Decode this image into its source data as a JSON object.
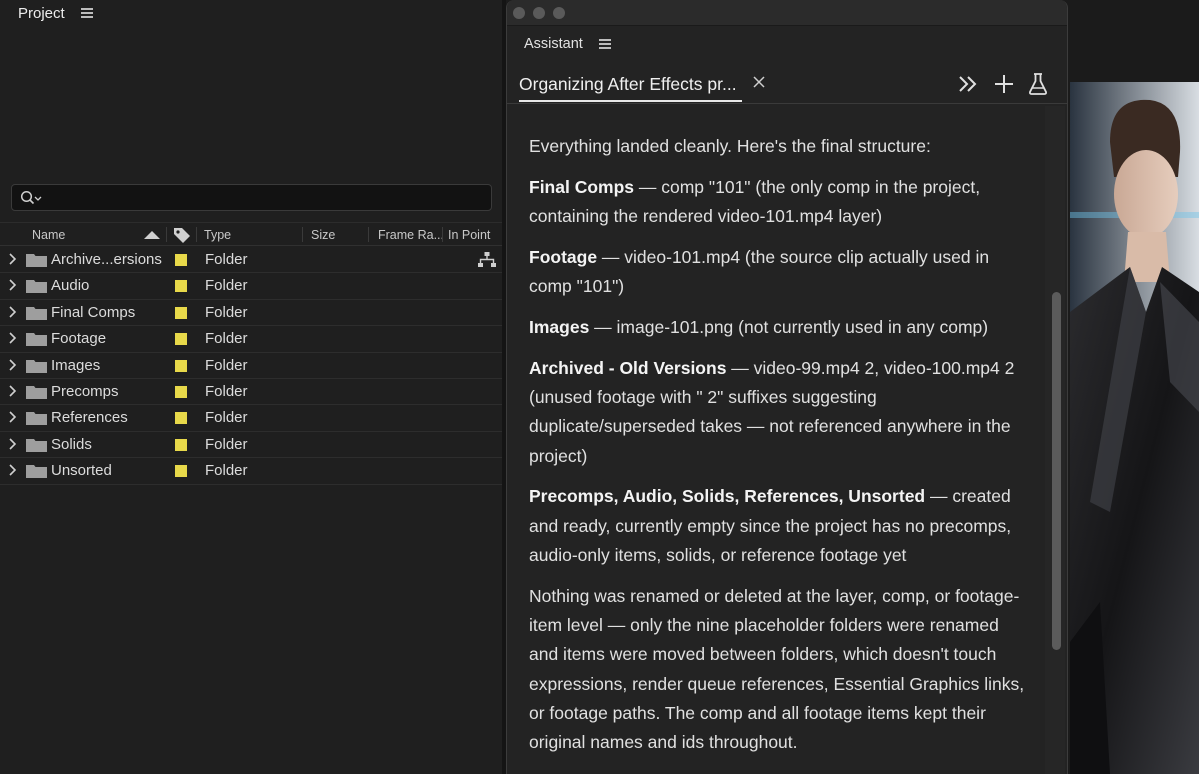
{
  "project_panel": {
    "title": "Project",
    "columns": {
      "name": "Name",
      "type": "Type",
      "size": "Size",
      "frame_rate": "Frame Ra...",
      "in_point": "In Point"
    },
    "rows": [
      {
        "name": "Archive...ersions",
        "type": "Folder"
      },
      {
        "name": "Audio",
        "type": "Folder"
      },
      {
        "name": "Final Comps",
        "type": "Folder"
      },
      {
        "name": "Footage",
        "type": "Folder"
      },
      {
        "name": "Images",
        "type": "Folder"
      },
      {
        "name": "Precomps",
        "type": "Folder"
      },
      {
        "name": "References",
        "type": "Folder"
      },
      {
        "name": "Solids",
        "type": "Folder"
      },
      {
        "name": "Unsorted",
        "type": "Folder"
      }
    ],
    "label_color": "#e8d94a"
  },
  "assistant": {
    "title": "Assistant",
    "tab_title": "Organizing After Effects pr...",
    "intro": "Everything landed cleanly. Here's the final structure:",
    "sections": [
      {
        "bold": "Final Comps",
        "text": " — comp \"101\" (the only comp in the project, containing the rendered video-101.mp4 layer)"
      },
      {
        "bold": "Footage",
        "text": " — video-101.mp4 (the source clip actually used in comp \"101\")"
      },
      {
        "bold": "Images",
        "text": " — image-101.png (not currently used in any comp)"
      },
      {
        "bold": "Archived - Old Versions",
        "text": " — video-99.mp4 2, video-100.mp4 2 (unused footage with \" 2\" suffixes suggesting duplicate/superseded takes — not referenced anywhere in the project)"
      },
      {
        "bold": "Precomps, Audio, Solids, References, Unsorted",
        "text": " — created and ready, currently empty since the project has no precomps, audio-only items, solids, or reference footage yet"
      }
    ],
    "closing": "Nothing was renamed or deleted at the layer, comp, or footage-item level — only the nine placeholder folders were renamed and items were moved between folders, which doesn't touch expressions, render queue references, Essential Graphics links, or footage paths. The comp and all footage items kept their original names and ids throughout."
  },
  "icons": {
    "search": "search-icon",
    "folder": "folder-icon",
    "expand": "chevron-right-icon",
    "close": "close-icon",
    "collapse": "double-chevron-right-icon",
    "add": "plus-icon",
    "labs": "flask-icon",
    "flowchart": "flowchart-icon",
    "menu": "hamburger-menu-icon"
  }
}
